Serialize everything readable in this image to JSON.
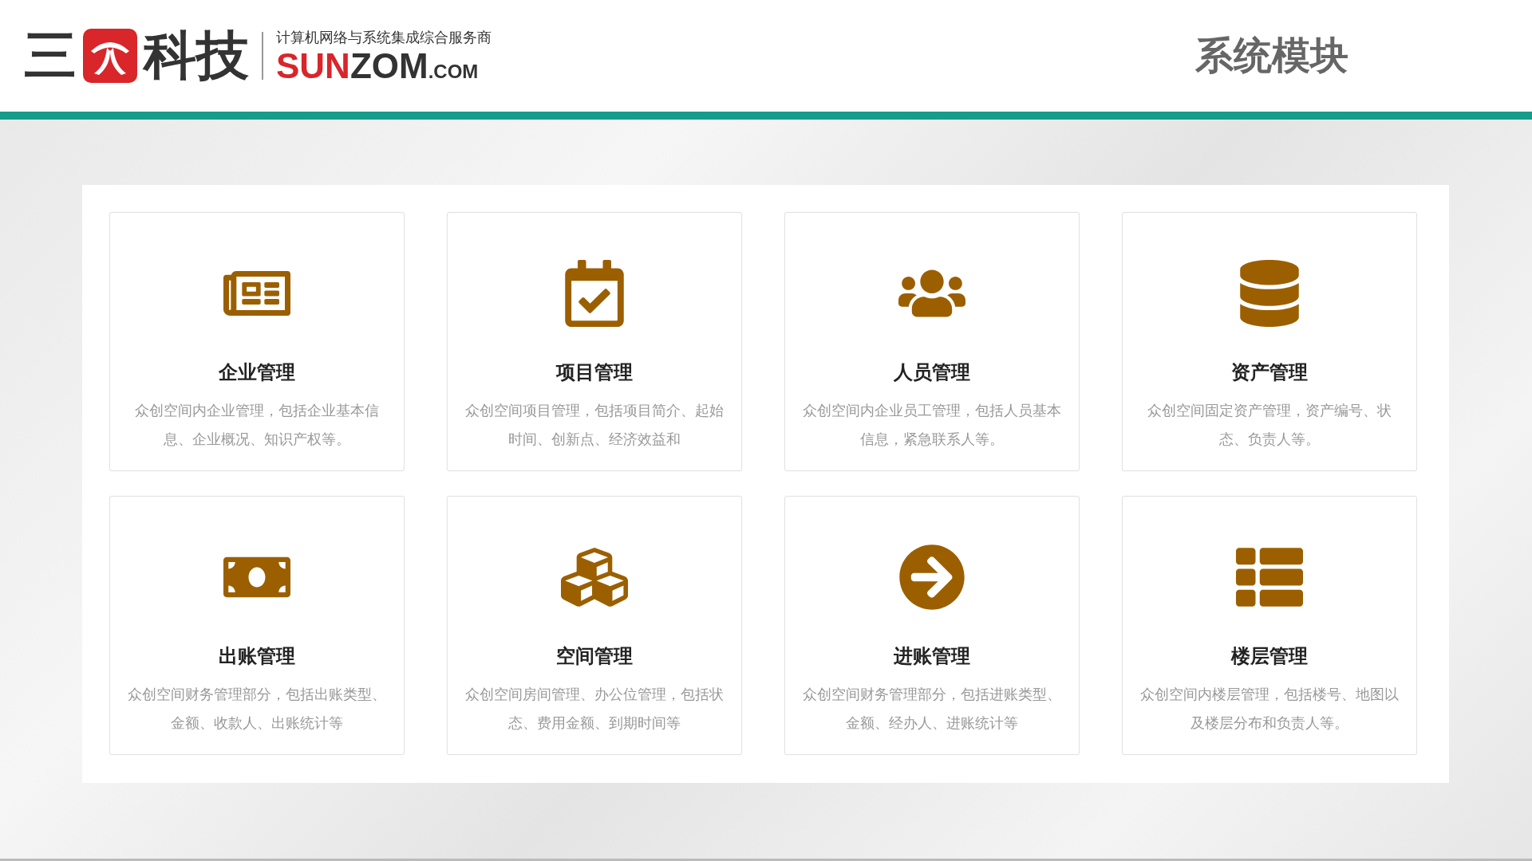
{
  "header": {
    "logo": {
      "lead": "三",
      "trail": "科技",
      "tagline": "计算机网络与系统集成综合服务商",
      "brand_red": "SUN",
      "brand_dark": "ZOM",
      "domain": ".COM"
    },
    "title": "系统模块"
  },
  "modules": [
    {
      "title": "企业管理",
      "description": "众创空间内企业管理，包括企业基本信息、企业概况、知识产权等。"
    },
    {
      "title": "项目管理",
      "description": "众创空间项目管理，包括项目简介、起始时间、创新点、经济效益和"
    },
    {
      "title": "人员管理",
      "description": "众创空间内企业员工管理，包括人员基本信息，紧急联系人等。"
    },
    {
      "title": "资产管理",
      "description": "众创空间固定资产管理，资产编号、状态、负责人等。"
    },
    {
      "title": "出账管理",
      "description": "众创空间财务管理部分，包括出账类型、金额、收款人、出账统计等"
    },
    {
      "title": "空间管理",
      "description": "众创空间房间管理、办公位管理，包括状态、费用金额、到期时间等"
    },
    {
      "title": "进账管理",
      "description": "众创空间财务管理部分，包括进账类型、金额、经办人、进账统计等"
    },
    {
      "title": "楼层管理",
      "description": "众创空间内楼层管理，包括楼号、地图以及楼层分布和负责人等。"
    }
  ]
}
